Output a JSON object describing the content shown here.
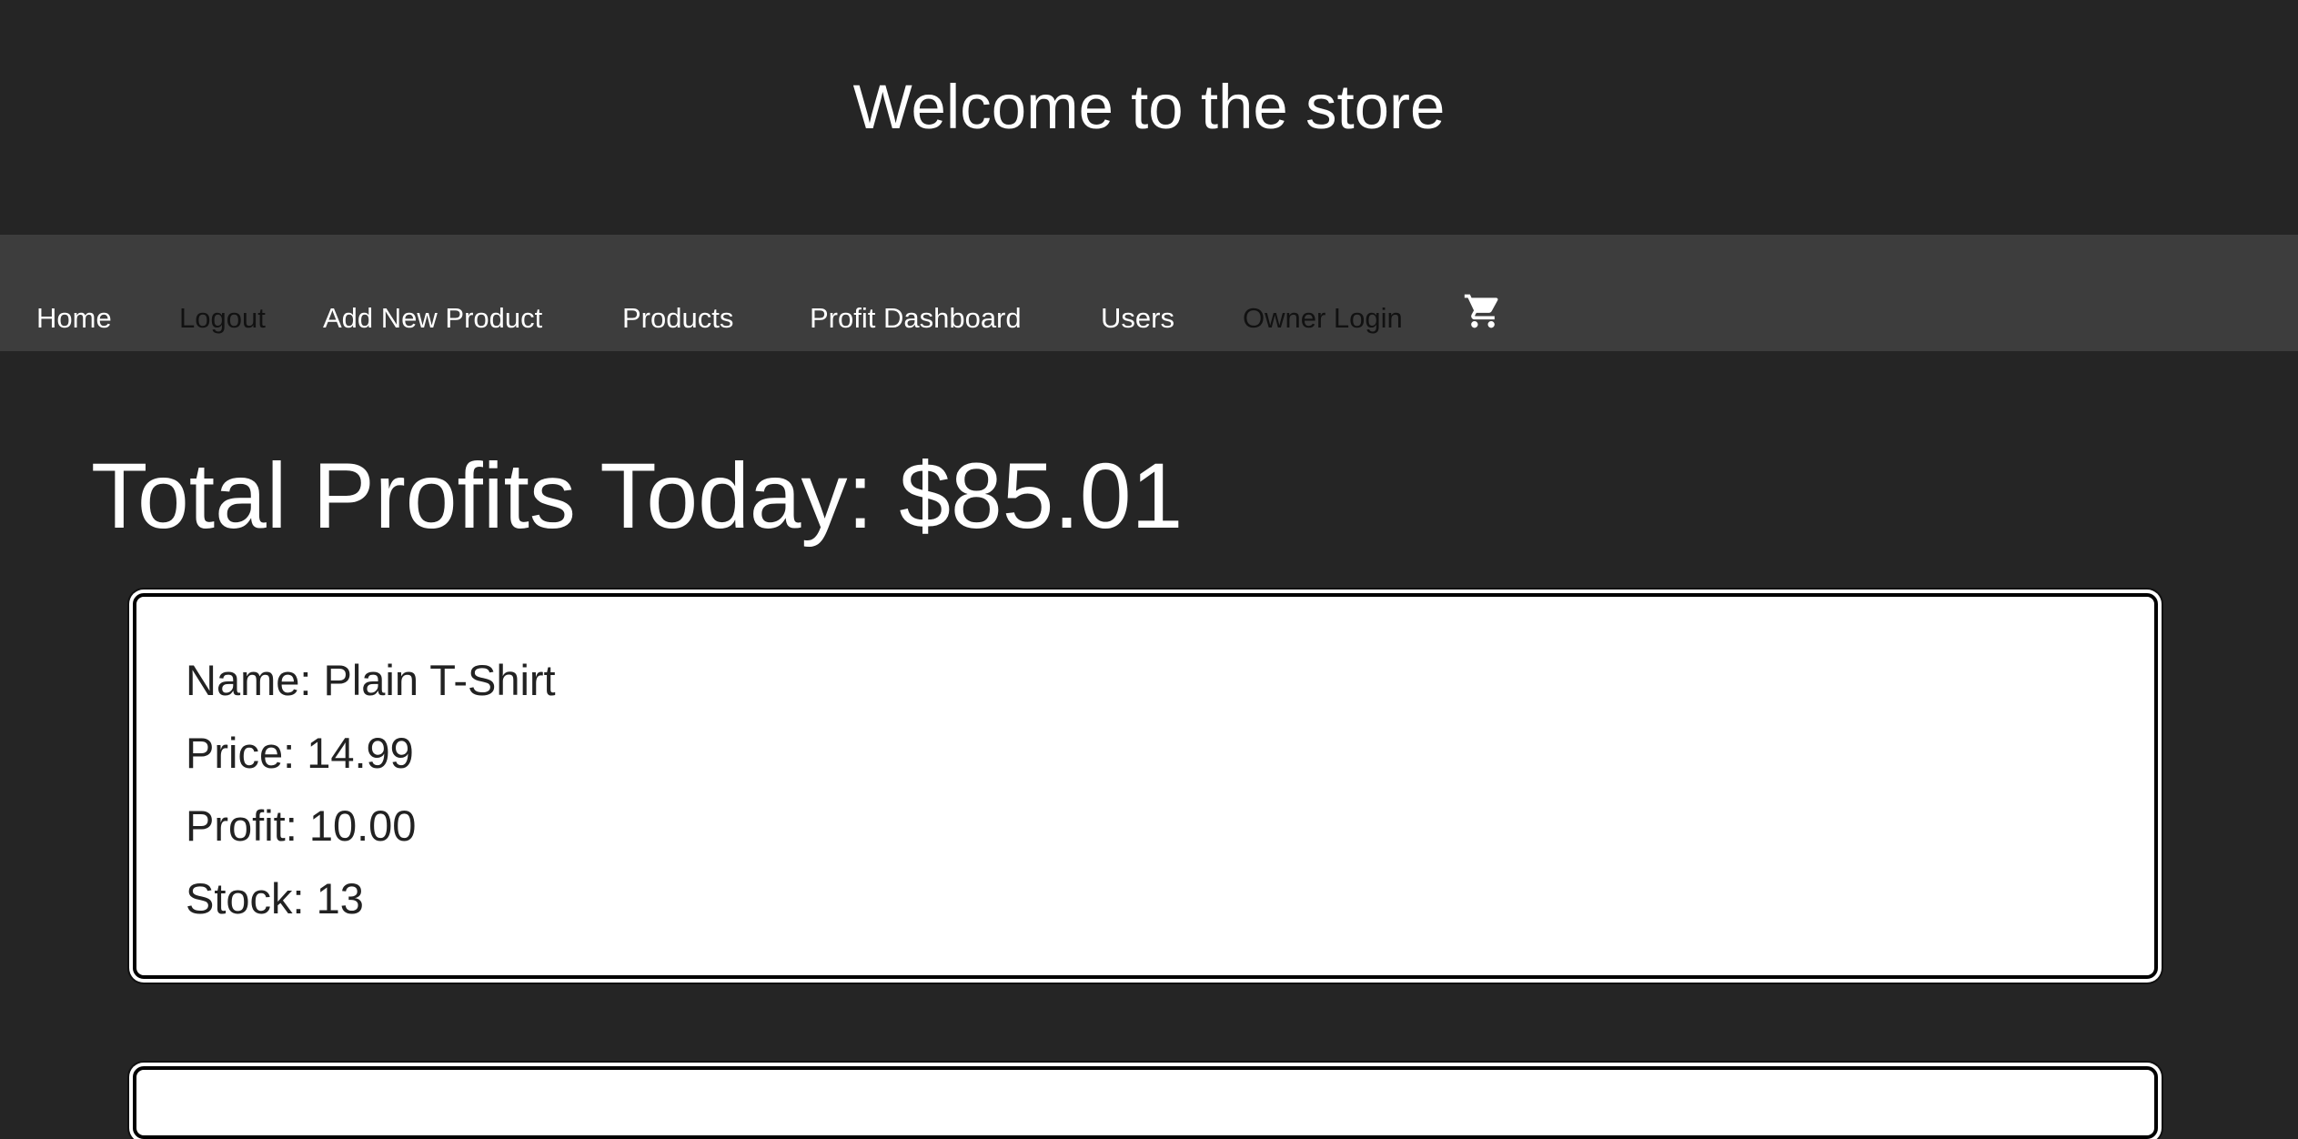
{
  "header": {
    "title": "Welcome to the store"
  },
  "nav": {
    "items": [
      {
        "label": "Home"
      },
      {
        "label": "Logout"
      },
      {
        "label": "Add New Product"
      },
      {
        "label": "Products"
      },
      {
        "label": "Profit Dashboard"
      },
      {
        "label": "Users"
      },
      {
        "label": "Owner Login"
      }
    ],
    "cart_icon": "shopping-cart-icon"
  },
  "main": {
    "total_profits": "Total Profits Today: $85.01",
    "products": [
      {
        "name": "Name: Plain T-Shirt",
        "price": "Price: 14.99",
        "profit": "Profit: 10.00",
        "stock": "Stock: 13"
      }
    ]
  },
  "colors": {
    "background": "#252525",
    "navbar": "#3d3d3d",
    "card": "#ffffff",
    "text_light": "#ffffff",
    "text_dark": "#222222"
  }
}
